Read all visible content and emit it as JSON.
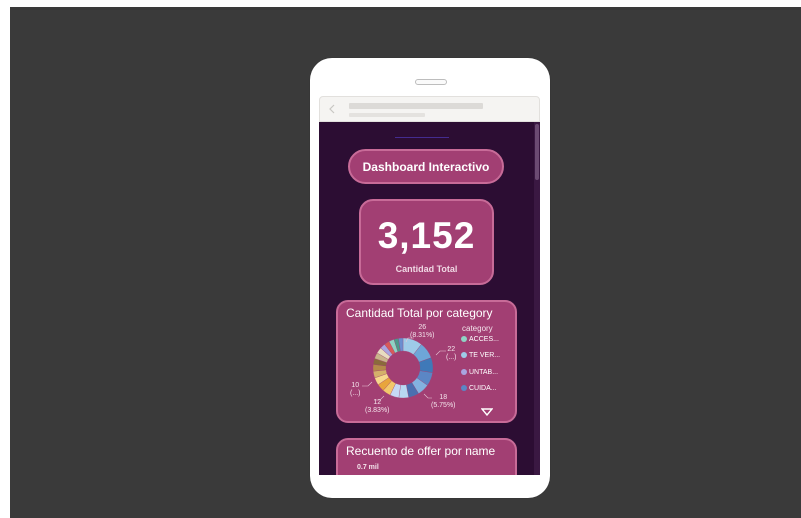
{
  "dashboard": {
    "title": "Dashboard Interactivo",
    "kpi": {
      "value": "3,152",
      "label": "Cantidad Total"
    }
  },
  "chart1": {
    "title": "Cantidad Total por category",
    "legend_title": "category",
    "legend": [
      {
        "label": "ACCES...",
        "color": "#8fd3c4"
      },
      {
        "label": "TE VER...",
        "color": "#9ecbe8"
      },
      {
        "label": "UNTAB...",
        "color": "#a9a4e0"
      },
      {
        "label": "CUIDA...",
        "color": "#5b86c5"
      }
    ],
    "data_labels": [
      {
        "value": "26",
        "pct": "(8.31%)"
      },
      {
        "value": "22",
        "pct": "(...)"
      },
      {
        "value": "18",
        "pct": "(5.75%)"
      },
      {
        "value": "12",
        "pct": "(3.83%)"
      },
      {
        "value": "10",
        "pct": "(...)"
      }
    ]
  },
  "chart2": {
    "title": "Recuento de offer por name",
    "ytick": "0.7 mil"
  },
  "chart_data": [
    {
      "type": "pie",
      "title": "Cantidad Total por category",
      "legend_title": "category",
      "slices": [
        {
          "value": 26,
          "label": "26 (8.31%)",
          "color": "#9ecbe8"
        },
        {
          "value": 22,
          "label": "22 (...)",
          "color": "#6ea6d8"
        },
        {
          "value": 20,
          "color": "#3f79b8"
        },
        {
          "value": 18,
          "label": "18 (5.75%)",
          "color": "#5b86c5"
        },
        {
          "value": 16,
          "color": "#83b2e0"
        },
        {
          "value": 14,
          "color": "#4a6fb0"
        },
        {
          "value": 13,
          "color": "#b8d8f2"
        },
        {
          "value": 12,
          "label": "12 (3.83%)",
          "color": "#c6d8f4"
        },
        {
          "value": 11,
          "color": "#f3c86b"
        },
        {
          "value": 10,
          "label": "10 (...)",
          "color": "#e8a53c"
        },
        {
          "value": 10,
          "color": "#f6d88c"
        },
        {
          "value": 9,
          "color": "#d4b06a"
        },
        {
          "value": 9,
          "color": "#b58a4a"
        },
        {
          "value": 8,
          "color": "#8a6a3c"
        },
        {
          "value": 8,
          "color": "#c9b48a"
        },
        {
          "value": 8,
          "color": "#e8dcc0"
        },
        {
          "value": 7,
          "color": "#a9a4e0"
        },
        {
          "value": 7,
          "color": "#d65a5a"
        },
        {
          "value": 7,
          "color": "#8fd3c4"
        },
        {
          "value": 6,
          "color": "#4a9a8a"
        },
        {
          "value": 6,
          "color": "#6a8fd0"
        }
      ]
    },
    {
      "type": "bar",
      "title": "Recuento de offer por name",
      "yticks": [
        "0.7 mil"
      ]
    }
  ]
}
